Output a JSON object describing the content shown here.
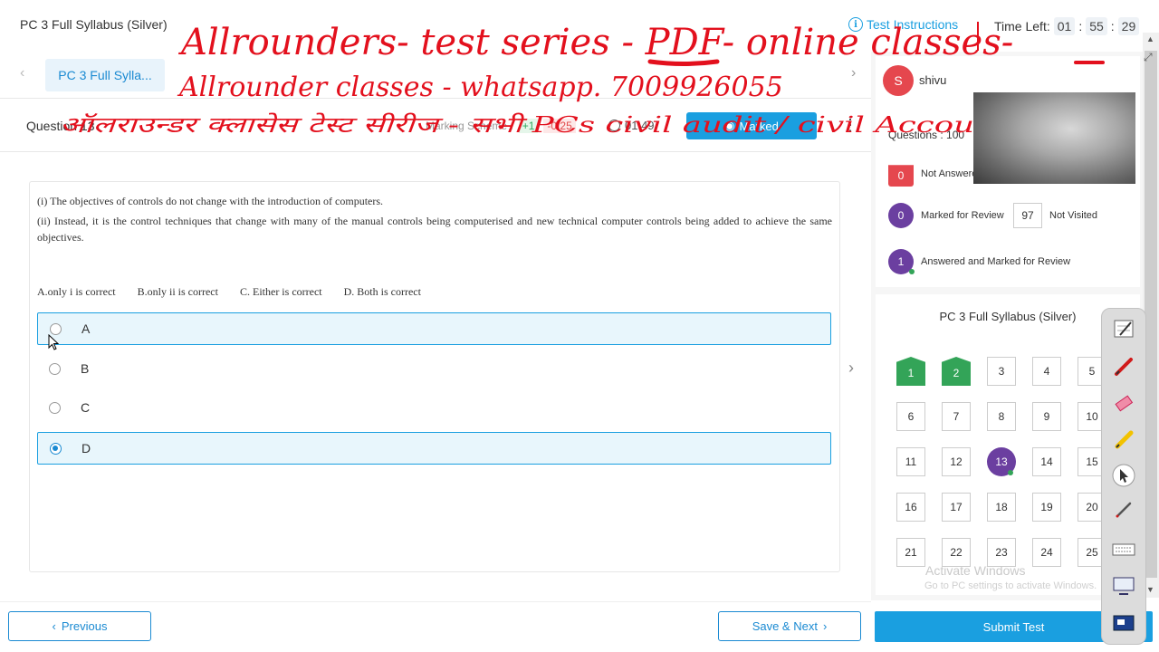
{
  "header": {
    "test_title": "PC 3 Full Syllabus (Silver)",
    "instructions_label": "Test Instructions",
    "time_left_label": "Time Left:",
    "time": {
      "hh": "01",
      "mm": "55",
      "ss": "29"
    }
  },
  "section_nav": {
    "active_tab": "PC 3 Full Sylla..."
  },
  "question_header": {
    "question_label": "Question 13",
    "marking_label": "Marking Scheme :",
    "positive": "+1",
    "negative": "-0.25",
    "timer": "01:49",
    "marked_label": "Marked"
  },
  "question": {
    "statement_1": "(i)  The objectives of controls do not change with the introduction of computers.",
    "statement_2": "(ii) Instead, it is the control techniques that change with many of the manual controls being computerised and new technical computer controls being added to achieve the same objectives.",
    "choices": [
      "A.only  i is correct",
      "B.only ii is correct",
      "C. Either is correct",
      "D. Both is correct"
    ],
    "options": [
      {
        "label": "A",
        "selected": false
      },
      {
        "label": "B",
        "selected": false
      },
      {
        "label": "C",
        "selected": false
      },
      {
        "label": "D",
        "selected": true
      }
    ]
  },
  "footer": {
    "previous_label": "Previous",
    "save_next_label": "Save & Next",
    "submit_label": "Submit Test"
  },
  "profile": {
    "avatar_initial": "S",
    "username": "shivu",
    "questions_count": "Questions : 100"
  },
  "legend": [
    {
      "count": "0",
      "label": "Not Answered",
      "style": "red"
    },
    {
      "count": "0",
      "label": "Marked for Review",
      "style": "purple"
    },
    {
      "count": "97",
      "label": "Not Visited",
      "style": "square"
    },
    {
      "count": "1",
      "label": "Answered and Marked for Review",
      "style": "purple"
    }
  ],
  "palette": {
    "title": "PC 3 Full Syllabus (Silver)",
    "numbers": [
      "1",
      "2",
      "3",
      "4",
      "5",
      "6",
      "7",
      "8",
      "9",
      "10",
      "11",
      "12",
      "13",
      "14",
      "15",
      "16",
      "17",
      "18",
      "19",
      "20",
      "21",
      "22",
      "23",
      "24",
      "25"
    ]
  },
  "watermark": {
    "line1": "Activate Windows",
    "line2": "Go to PC settings to activate Windows."
  },
  "handwriting": {
    "line1": "Allrounders- test series - PDF- online classes-",
    "line2": "Allrounder classes - whatsapp. 7009926055",
    "line3": "ऑलराउन्डर क्लासेस टेस्ट सीरीज - सभी PCs civil audit / civil Accou"
  },
  "colors": {
    "accent": "#1a9fe0",
    "answered": "#33a458",
    "not_answered": "#e5474e",
    "review": "#6b3fa0",
    "ink": "#e3101d"
  }
}
